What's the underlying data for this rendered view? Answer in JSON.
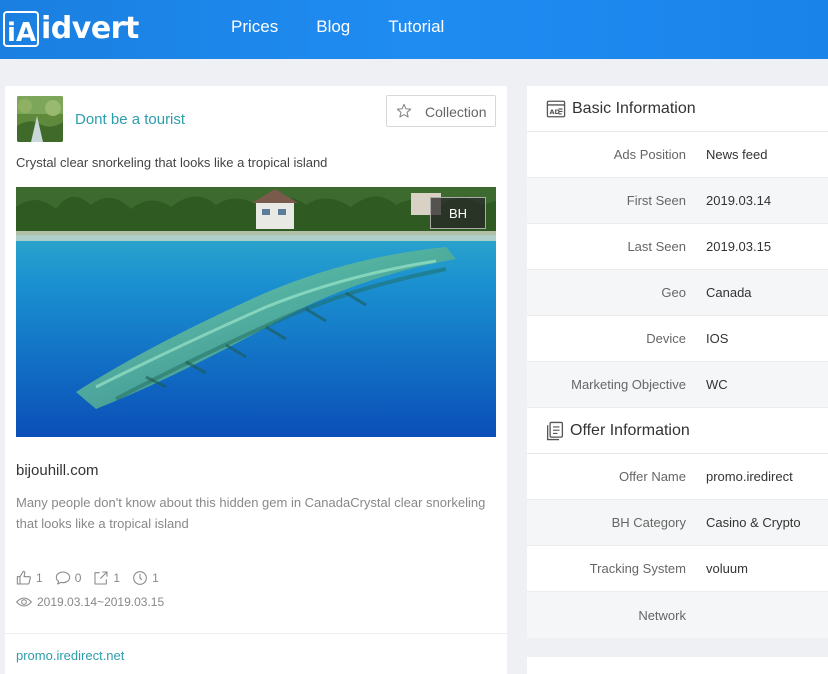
{
  "header": {
    "logo_text": "idvert",
    "logo_mark": "iA",
    "nav": [
      "Prices",
      "Blog",
      "Tutorial"
    ]
  },
  "ad": {
    "page_name": "Dont be a tourist",
    "collection_label": "Collection",
    "text": "Crystal clear snorkeling that looks like a tropical island",
    "badge": "BH",
    "domain": "bijouhill.com",
    "description": "Many people don't know about this hidden gem in CanadaCrystal clear snorkeling that looks like a tropical island",
    "stats": {
      "likes": "1",
      "comments": "0",
      "shares": "1",
      "views": "1"
    },
    "date_range": "2019.03.14~2019.03.15",
    "offer_link": "promo.iredirect.net"
  },
  "basic_info": {
    "title": "Basic Information",
    "rows": [
      {
        "label": "Ads Position",
        "value": "News feed"
      },
      {
        "label": "First Seen",
        "value": "2019.03.14"
      },
      {
        "label": "Last Seen",
        "value": "2019.03.15"
      },
      {
        "label": "Geo",
        "value": "Canada"
      },
      {
        "label": "Device",
        "value": "IOS"
      },
      {
        "label": "Marketing Objective",
        "value": "WC"
      }
    ]
  },
  "offer_info": {
    "title": "Offer Information",
    "rows": [
      {
        "label": "Offer Name",
        "value": "promo.iredirect"
      },
      {
        "label": "BH Category",
        "value": "Casino & Crypto"
      },
      {
        "label": "Tracking System",
        "value": "voluum"
      },
      {
        "label": "Network",
        "value": ""
      }
    ]
  },
  "colors": {
    "header": "#1f8cf2",
    "accent": "#2d9dad"
  }
}
